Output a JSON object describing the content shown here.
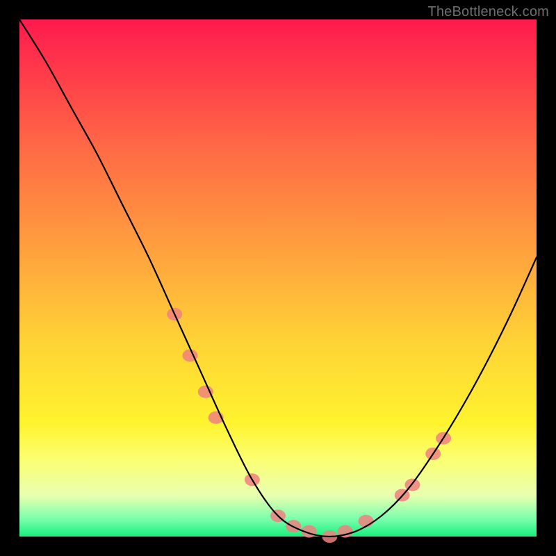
{
  "watermark": "TheBottleneck.com",
  "chart_data": {
    "type": "line",
    "title": "",
    "xlabel": "",
    "ylabel": "",
    "xlim": [
      0,
      100
    ],
    "ylim": [
      0,
      100
    ],
    "grid": false,
    "legend": false,
    "series": [
      {
        "name": "bottleneck-curve",
        "color": "#000000",
        "x": [
          0,
          5,
          10,
          15,
          20,
          25,
          30,
          35,
          40,
          45,
          50,
          55,
          60,
          65,
          70,
          75,
          80,
          85,
          90,
          95,
          100
        ],
        "y": [
          100,
          92,
          83,
          74,
          64,
          54,
          43,
          32,
          21,
          11,
          4,
          1,
          0,
          1,
          4,
          9,
          16,
          24,
          33,
          43,
          54
        ]
      }
    ],
    "markers": [
      {
        "name": "highlight-dots",
        "color": "#f08080",
        "points": [
          {
            "x": 30,
            "y": 43
          },
          {
            "x": 33,
            "y": 35
          },
          {
            "x": 36,
            "y": 28
          },
          {
            "x": 38,
            "y": 23
          },
          {
            "x": 45,
            "y": 11
          },
          {
            "x": 50,
            "y": 4
          },
          {
            "x": 53,
            "y": 2
          },
          {
            "x": 56,
            "y": 1
          },
          {
            "x": 60,
            "y": 0
          },
          {
            "x": 63,
            "y": 1
          },
          {
            "x": 67,
            "y": 3
          },
          {
            "x": 74,
            "y": 8
          },
          {
            "x": 76,
            "y": 10
          },
          {
            "x": 80,
            "y": 16
          },
          {
            "x": 82,
            "y": 19
          }
        ]
      }
    ],
    "background_gradient": {
      "top": "#ff1a4e",
      "mid": "#fff32e",
      "bottom": "#18f07e"
    }
  }
}
